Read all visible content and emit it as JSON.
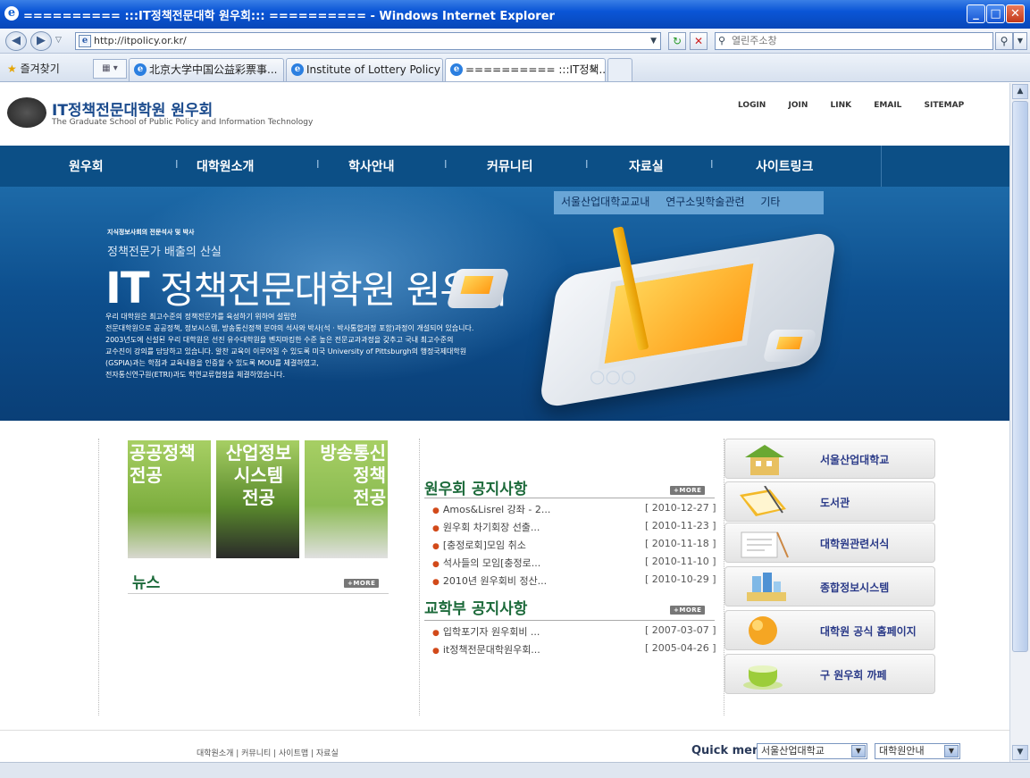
{
  "window": {
    "title": "========== :::IT정책전문대학 원우회::: ========== - Windows Internet Explorer"
  },
  "browser": {
    "address": "http://itpolicy.or.kr/",
    "search_placeholder": "열린주소창",
    "favorites_label": "즐겨찾기",
    "tabs": [
      {
        "label": "北京大学中国公益彩票事..."
      },
      {
        "label": "Institute of Lottery Policy"
      },
      {
        "label": "========== :::IT정책..."
      }
    ]
  },
  "header": {
    "logo_title": "IT정책전문대학원 원우회",
    "logo_subtitle": "The Graduate School of Public Policy and Information Technology",
    "toplinks": [
      "LOGIN",
      "JOIN",
      "LINK",
      "EMAIL",
      "SITEMAP"
    ]
  },
  "nav": {
    "items": [
      "원우회",
      "대학원소개",
      "학사안내",
      "커뮤니티",
      "자료실",
      "사이트링크"
    ]
  },
  "subnav": {
    "items": [
      "서울산업대학교교내",
      "연구소및학술관련",
      "기타"
    ]
  },
  "hero": {
    "tagline_small": "지식정보사회의 전문석사 및 박사",
    "tagline": "정책전문가 배출의 산실",
    "title_it": "IT",
    "title_rest": " 정책전문대학원 원우회",
    "body": [
      "우리 대학원은 최고수준의 정책전문가를 육성하기 위하여 설립한",
      "전문대학원으로 공공정책, 정보시스템, 방송통신정책 분야의 석사와 박사(석 · 박사통합과정 포함)과정이 개설되어 있습니다.",
      "2003년도에 신설된 우리 대학원은 선진 유수대학원을 벤치마킹한 수준 높은 전문교과과정을 갖추고 국내 최고수준의",
      "교수진이 강의를 담당하고 있습니다. 알찬 교육이 이루어질 수 있도록 미국 University of Pittsburgh의 행정국제대학원",
      "(GSPIA)과는 학점과 교육내용을 인증할 수 있도록 MOU를 체결하였고,",
      "전자통신연구원(ETRI)과도 학연교류협정을 체결하였습니다."
    ]
  },
  "majors": [
    {
      "lines": [
        "공공정책",
        "전공"
      ]
    },
    {
      "lines": [
        "산업정보",
        "시스템",
        "전공"
      ]
    },
    {
      "lines": [
        "방송통신",
        "정책",
        "전공"
      ]
    }
  ],
  "news": {
    "title": "뉴스",
    "more": "+MORE"
  },
  "notice1": {
    "title": "원우회 공지사항",
    "more": "+MORE",
    "rows": [
      {
        "title": "Amos&Lisrel 강좌 - 2...",
        "date": "[ 2010-12-27 ]"
      },
      {
        "title": "원우회 차기회장 선출...",
        "date": "[ 2010-11-23 ]"
      },
      {
        "title": "[충정로회]모임 취소",
        "date": "[ 2010-11-18 ]"
      },
      {
        "title": "석사들의 모임[충정로...",
        "date": "[ 2010-11-10 ]"
      },
      {
        "title": "2010년 원우회비 정산...",
        "date": "[ 2010-10-29 ]"
      }
    ]
  },
  "notice2": {
    "title": "교학부 공지사항",
    "more": "+MORE",
    "rows": [
      {
        "title": "입학포기자 원우회비 ...",
        "date": "[ 2007-03-07 ]"
      },
      {
        "title": "it정책전문대학원우회...",
        "date": "[ 2005-04-26 ]"
      }
    ]
  },
  "quicklinks": [
    {
      "label": "서울산업대학교",
      "icon": "building-icon"
    },
    {
      "label": "도서관",
      "icon": "book-icon"
    },
    {
      "label": "대학원관련서식",
      "icon": "document-icon"
    },
    {
      "label": "종합정보시스템",
      "icon": "buildings-icon"
    },
    {
      "label": "대학원 공식 홈페이지",
      "icon": "globe-icon"
    },
    {
      "label": "구 원우회 까페",
      "icon": "teacup-icon"
    }
  ],
  "footer": {
    "links": "대학원소개 | 커뮤니티 | 사이트맵 | 자료실",
    "quick_label": "Quick menu",
    "select1": "서울산업대학교",
    "select2": "대학원안내"
  }
}
